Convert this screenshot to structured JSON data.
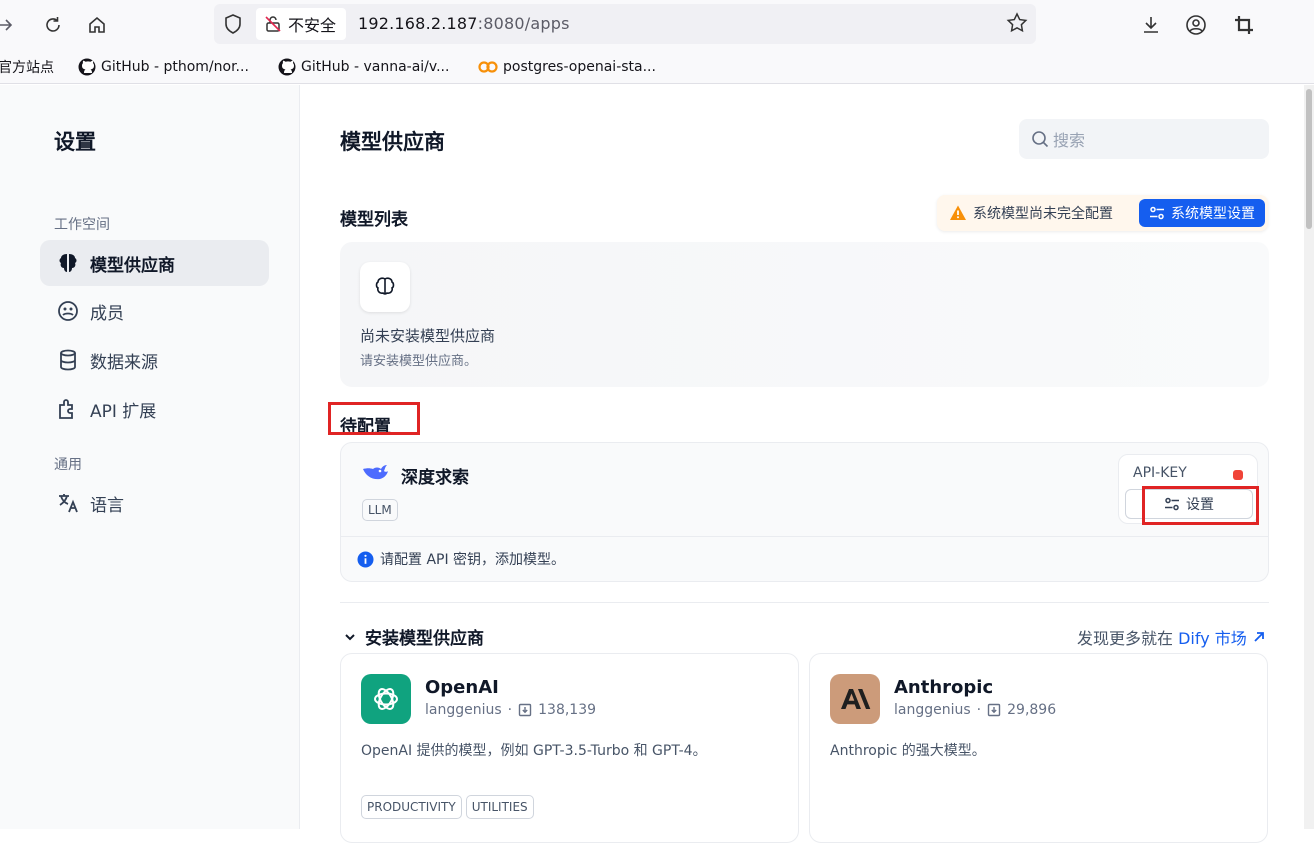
{
  "browser": {
    "insecure_label": "不安全",
    "url_host": "192.168.2.187",
    "url_rest": ":8080/apps",
    "bookmarks": [
      "官方站点",
      "GitHub - pthom/nor...",
      "GitHub - vanna-ai/v...",
      "postgres-openai-sta..."
    ]
  },
  "sidebar": {
    "title": "设置",
    "group_workspace": "工作空间",
    "items": [
      {
        "label": "模型供应商",
        "icon": "brain-icon",
        "active": true
      },
      {
        "label": "成员",
        "icon": "members-icon"
      },
      {
        "label": "数据来源",
        "icon": "database-icon"
      },
      {
        "label": "API 扩展",
        "icon": "puzzle-icon"
      }
    ],
    "group_general": "通用",
    "language_label": "语言"
  },
  "main": {
    "title": "模型供应商",
    "search_placeholder": "搜索",
    "model_list_title": "模型列表",
    "warning_text": "系统模型尚未完全配置",
    "system_model_button": "系统模型设置",
    "empty_title": "尚未安装模型供应商",
    "empty_subtitle": "请安装模型供应商。",
    "pending_title": "待配置",
    "pending_provider": {
      "name": "深度求索",
      "tag": "LLM",
      "api_key_label": "API-KEY",
      "settings_button": "设置",
      "note": "请配置 API 密钥，添加模型。"
    },
    "install_title": "安装模型供应商",
    "market_text": "发现更多就在",
    "market_link": "Dify 市场",
    "providers": [
      {
        "name": "OpenAI",
        "author": "langgenius",
        "downloads": "138,139",
        "description": "OpenAI 提供的模型，例如 GPT-3.5-Turbo 和 GPT-4。",
        "tags": [
          "PRODUCTIVITY",
          "UTILITIES"
        ],
        "color": "#10a37f"
      },
      {
        "name": "Anthropic",
        "author": "langgenius",
        "downloads": "29,896",
        "description": "Anthropic 的强大模型。",
        "tags": [],
        "color": "#cc9b7a"
      }
    ]
  },
  "colors": {
    "accent": "#155eef",
    "warning": "#f79009",
    "error": "#f04438",
    "highlight_box": "#e02424"
  }
}
